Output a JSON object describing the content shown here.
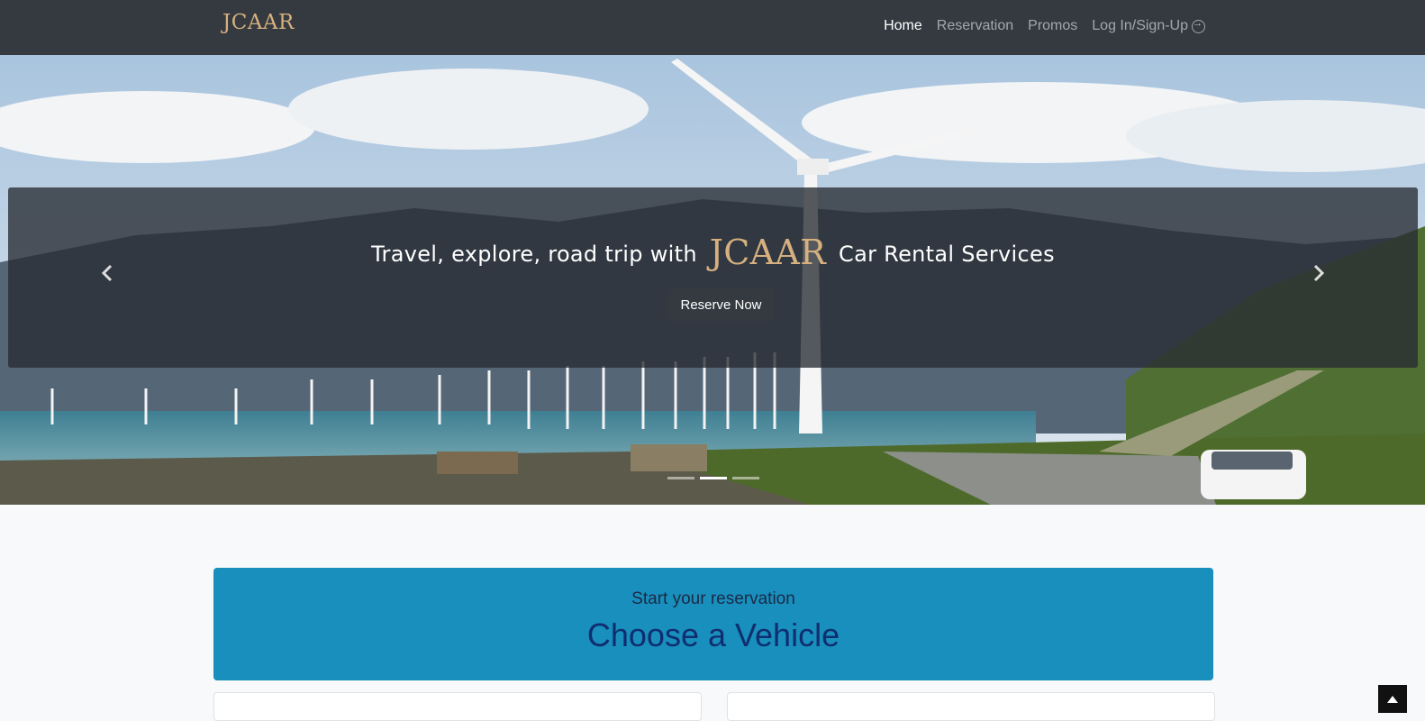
{
  "navbar": {
    "brand": "JCAAR",
    "links": [
      {
        "label": "Home",
        "active": true
      },
      {
        "label": "Reservation"
      },
      {
        "label": "Promos"
      },
      {
        "label": "Log In/Sign-Up"
      }
    ]
  },
  "hero": {
    "caption_pre": "Travel, explore, road trip with",
    "caption_brand": "JCAAR",
    "caption_post": "Car Rental Services",
    "button_label": "Reserve Now",
    "slide_count": 3,
    "active_slide": 1
  },
  "reservation": {
    "subtitle": "Start your reservation",
    "title": "Choose a Vehicle"
  },
  "colors": {
    "navbar": "#343a40",
    "brand": "#d6b07f",
    "banner": "#198fbd",
    "banner_title": "#0f2e70"
  }
}
